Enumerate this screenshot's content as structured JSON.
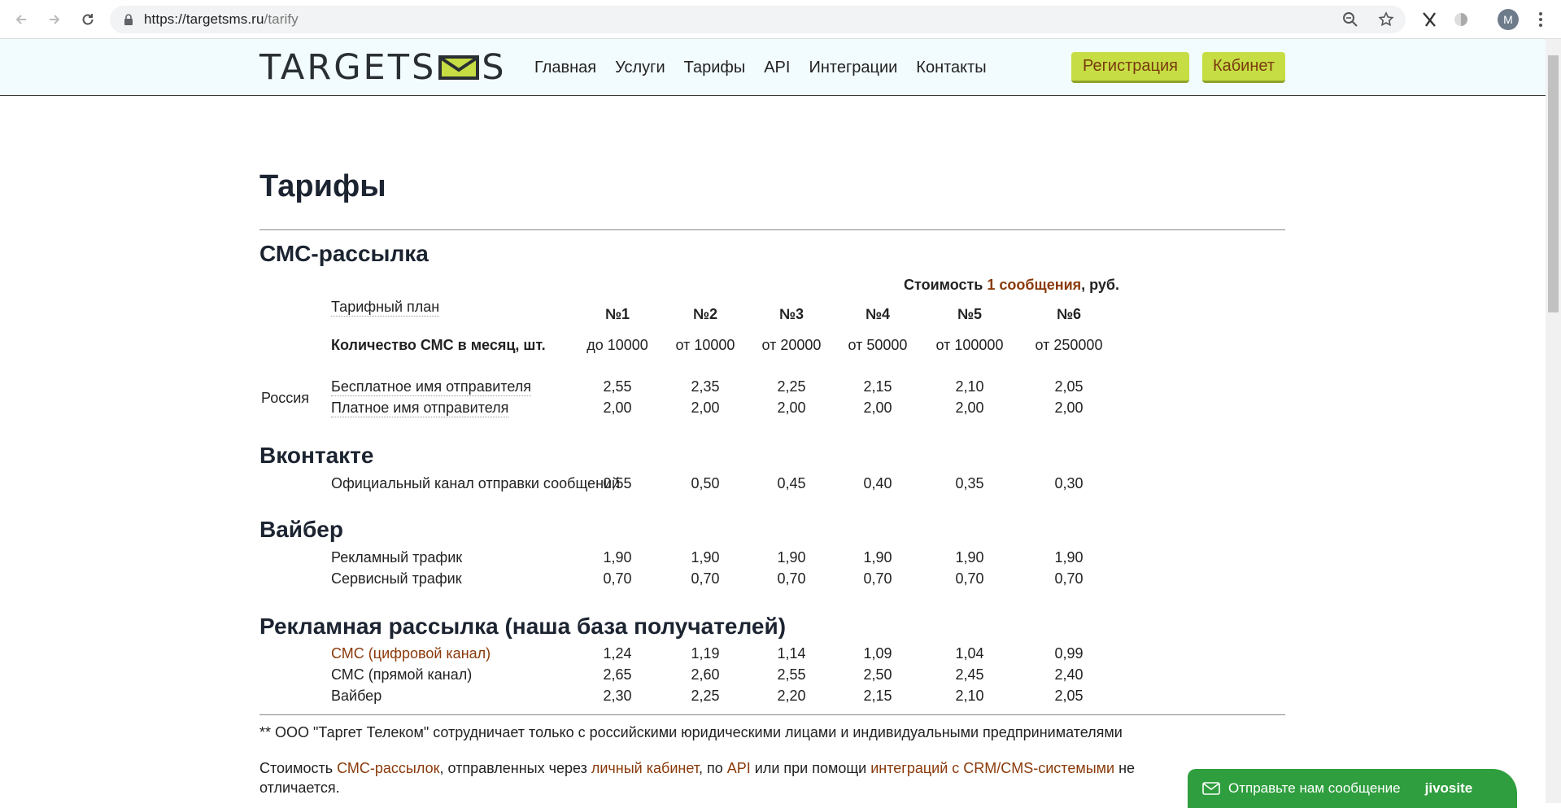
{
  "browser": {
    "url_host": "https://targetsms.ru",
    "url_path": "/tarify",
    "avatar_letter": "M"
  },
  "header": {
    "logo_left": "TARGETS",
    "logo_right": "S",
    "nav": [
      "Главная",
      "Услуги",
      "Тарифы",
      "API",
      "Интеграции",
      "Контакты"
    ],
    "register_label": "Регистрация",
    "cabinet_label": "Кабинет",
    "accent_color": "#c6dd43"
  },
  "page": {
    "title": "Тарифы"
  },
  "sms": {
    "section_title": "СМС-рассылка",
    "cost_prefix": "Стоимость ",
    "cost_link": "1 сообщения",
    "cost_suffix": ", руб.",
    "plan_label": "Тарифный план",
    "qty_label": "Количество СМС в месяц, шт.",
    "plans": [
      "№1",
      "№2",
      "№3",
      "№4",
      "№5",
      "№6"
    ],
    "quantities": [
      "до 10000",
      "от 10000",
      "от 20000",
      "от 50000",
      "от 100000",
      "от 250000"
    ],
    "region": "Россия",
    "rows": [
      {
        "label": "Бесплатное имя отправителя",
        "values": [
          "2,55",
          "2,35",
          "2,25",
          "2,15",
          "2,10",
          "2,05"
        ]
      },
      {
        "label": "Платное имя отправителя",
        "values": [
          "2,00",
          "2,00",
          "2,00",
          "2,00",
          "2,00",
          "2,00"
        ]
      }
    ]
  },
  "vk": {
    "section_title": "Вконтакте",
    "rows": [
      {
        "label": "Официальный канал отправки сообщений",
        "values": [
          "0,55",
          "0,50",
          "0,45",
          "0,40",
          "0,35",
          "0,30"
        ]
      }
    ]
  },
  "viber": {
    "section_title": "Вайбер",
    "rows": [
      {
        "label": "Рекламный трафик",
        "values": [
          "1,90",
          "1,90",
          "1,90",
          "1,90",
          "1,90",
          "1,90"
        ]
      },
      {
        "label": "Сервисный трафик",
        "values": [
          "0,70",
          "0,70",
          "0,70",
          "0,70",
          "0,70",
          "0,70"
        ]
      }
    ]
  },
  "ads": {
    "section_title": "Рекламная рассылка (наша база получателей)",
    "rows": [
      {
        "label": "СМС (цифровой канал)",
        "values": [
          "1,24",
          "1,19",
          "1,14",
          "1,09",
          "1,04",
          "0,99"
        ]
      },
      {
        "label": "СМС (прямой канал)",
        "values": [
          "2,65",
          "2,60",
          "2,55",
          "2,50",
          "2,45",
          "2,40"
        ]
      },
      {
        "label": "Вайбер",
        "values": [
          "2,30",
          "2,25",
          "2,20",
          "2,15",
          "2,10",
          "2,05"
        ]
      }
    ]
  },
  "footer": {
    "note": "** ООО \"Таргет Телеком\" сотрудничает только с российскими юридическими лицами и индивидуальными предпринимателями",
    "p_1": "Стоимость ",
    "p_link1": "СМС-рассылок",
    "p_2": ", отправленных через ",
    "p_link2": "личный кабинет",
    "p_3": ", по ",
    "p_link3": "API",
    "p_4": " или при помощи ",
    "p_link4": "интеграций с CRM/CMS-системыми",
    "p_5": " не",
    "p_6": "отличается."
  },
  "jivo": {
    "label": "Отправьте нам сообщение",
    "brand": "jivosite"
  }
}
